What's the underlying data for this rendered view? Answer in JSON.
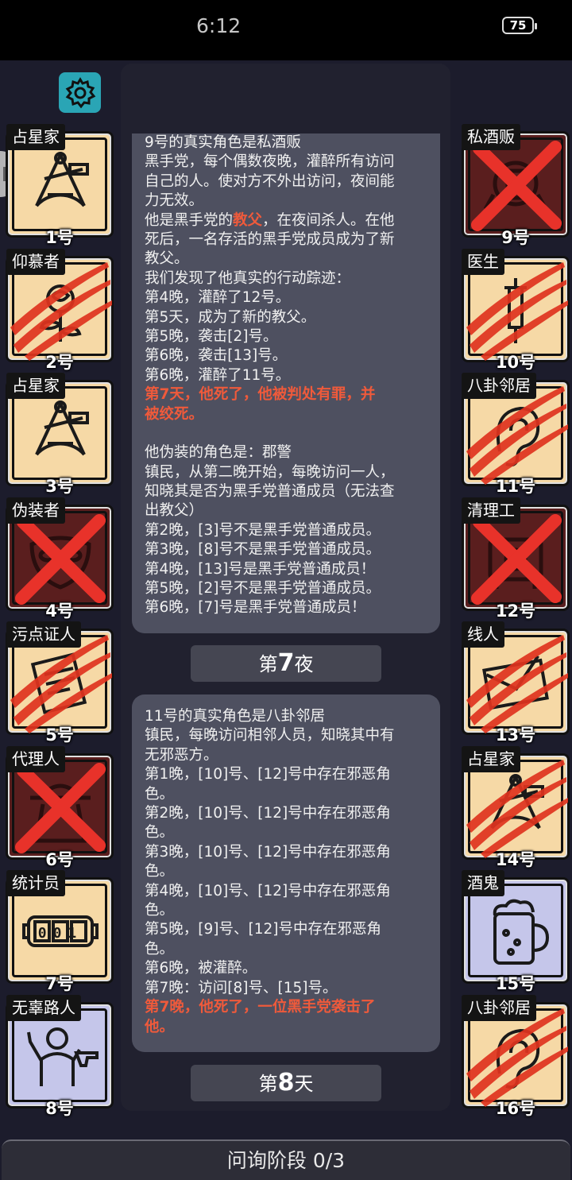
{
  "status_bar": {
    "time": "6:12",
    "battery": "75"
  },
  "left_players": [
    {
      "role": "占星家",
      "number": "1号",
      "state": "alive",
      "icon": "sextant-icon"
    },
    {
      "role": "仰慕者",
      "number": "2号",
      "state": "clawed",
      "icon": "rose-icon"
    },
    {
      "role": "占星家",
      "number": "3号",
      "state": "alive",
      "icon": "sextant-icon"
    },
    {
      "role": "伪装者",
      "number": "4号",
      "state": "crossed",
      "icon": "mask-icon"
    },
    {
      "role": "污点证人",
      "number": "5号",
      "state": "clawed",
      "icon": "document-icon"
    },
    {
      "role": "代理人",
      "number": "6号",
      "state": "crossed",
      "icon": "hat-icon"
    },
    {
      "role": "统计员",
      "number": "7号",
      "state": "alive",
      "icon": "counter-icon",
      "counter": "001"
    },
    {
      "role": "无辜路人",
      "number": "8号",
      "state": "alive",
      "icon": "hostage-icon"
    }
  ],
  "right_players": [
    {
      "role": "私酒贩",
      "number": "9号",
      "state": "crossed",
      "icon": "bottle-icon"
    },
    {
      "role": "医生",
      "number": "10号",
      "state": "clawed",
      "icon": "syringe-icon"
    },
    {
      "role": "八卦邻居",
      "number": "11号",
      "state": "clawed",
      "icon": "ear-icon"
    },
    {
      "role": "清理工",
      "number": "12号",
      "state": "crossed",
      "icon": "machine-icon"
    },
    {
      "role": "线人",
      "number": "13号",
      "state": "clawed",
      "icon": "envelope-icon"
    },
    {
      "role": "占星家",
      "number": "14号",
      "state": "clawed",
      "icon": "sextant-icon"
    },
    {
      "role": "酒鬼",
      "number": "15号",
      "state": "alive",
      "icon": "beer-icon"
    },
    {
      "role": "八卦邻居",
      "number": "16号",
      "state": "clawed",
      "icon": "ear-icon"
    }
  ],
  "log_card_1": {
    "l1": "9号的真实角色是私酒贩",
    "l2": "黑手党，每个偶数夜晚，灌醉所有访问",
    "l3": "自己的人。使对方不外出访问，夜间能",
    "l4": "力无效。",
    "l5a": "他是黑手党的",
    "l5b": "教父",
    "l5c": "，在夜间杀人。在他",
    "l6": "死后，一名存活的黑手党成员成为了新",
    "l7": "教父。",
    "l8": "我们发现了他真实的行动踪迹：",
    "l9": "第4晚，灌醉了12号。",
    "l10": "第5天，成为了新的教父。",
    "l11": "第5晚，袭击[2]号。",
    "l12": "第6晚，袭击[13]号。",
    "l13": "第6晚，灌醉了11号。",
    "l14": "第7天，他死了，他被判处有罪，并",
    "l15": "被绞死。",
    "l16": "他伪装的角色是：郡警",
    "l17": "镇民，从第二晚开始，每晚访问一人，",
    "l18": "知晓其是否为黑手党普通成员（无法查",
    "l19": "出教父）",
    "l20": "第2晚，[3]号不是黑手党普通成员。",
    "l21": "第3晚，[8]号不是黑手党普通成员。",
    "l22": "第4晚，[13]号是黑手党普通成员！",
    "l23": "第5晚，[2]号不是黑手党普通成员。",
    "l24": "第6晚，[7]号是黑手党普通成员！"
  },
  "night_header": {
    "prefix": "第",
    "number": "7",
    "suffix": "夜"
  },
  "log_card_2": {
    "l1": "11号的真实角色是八卦邻居",
    "l2": "镇民，每晚访问相邻人员，知晓其中有",
    "l3": "无邪恶方。",
    "l4": "第1晚，[10]号、[12]号中存在邪恶角",
    "l5": "色。",
    "l6": "第2晚，[10]号、[12]号中存在邪恶角",
    "l7": "色。",
    "l8": "第3晚，[10]号、[12]号中存在邪恶角",
    "l9": "色。",
    "l10": "第4晚，[10]号、[12]号中存在邪恶角",
    "l11": "色。",
    "l12": "第5晚，[9]号、[12]号中存在邪恶角",
    "l13": "色。",
    "l14": "第6晚，被灌醉。",
    "l15": "第7晚：访问[8]号、[15]号。",
    "l16": "第7晚，他死了，一位黑手党袭击了",
    "l17": "他。"
  },
  "day_header": {
    "prefix": "第",
    "number": "8",
    "suffix": "天"
  },
  "phase": "问询阶段 0/3",
  "colors": {
    "alive_card": "#f6d9a6",
    "dead_card": "#5a1e1e",
    "townsfolk_blue": "#c5c6ea",
    "accent_red": "#ef5a3b",
    "gear_teal": "#2aa5b5"
  }
}
